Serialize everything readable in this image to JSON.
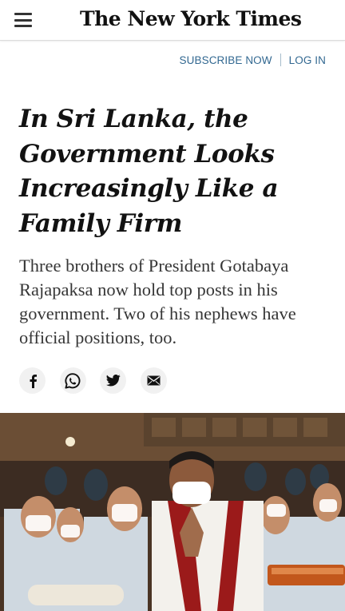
{
  "header": {
    "logo_text": "The New York Times",
    "menu_icon": "hamburger-menu-icon"
  },
  "account": {
    "subscribe_label": "SUBSCRIBE NOW",
    "login_label": "LOG IN"
  },
  "article": {
    "headline": "In Sri Lanka, the Government Looks Increasingly Like a Family Firm",
    "summary": "Three brothers of President Gotabaya Rajapaksa now hold top posts in his government. Two of his nephews have official positions, too."
  },
  "share": {
    "icons": [
      "facebook-icon",
      "whatsapp-icon",
      "twitter-icon",
      "email-icon"
    ]
  },
  "colors": {
    "link": "#326891",
    "headline": "#121212",
    "summary": "#363636",
    "share_bg": "#f1f1f1"
  }
}
